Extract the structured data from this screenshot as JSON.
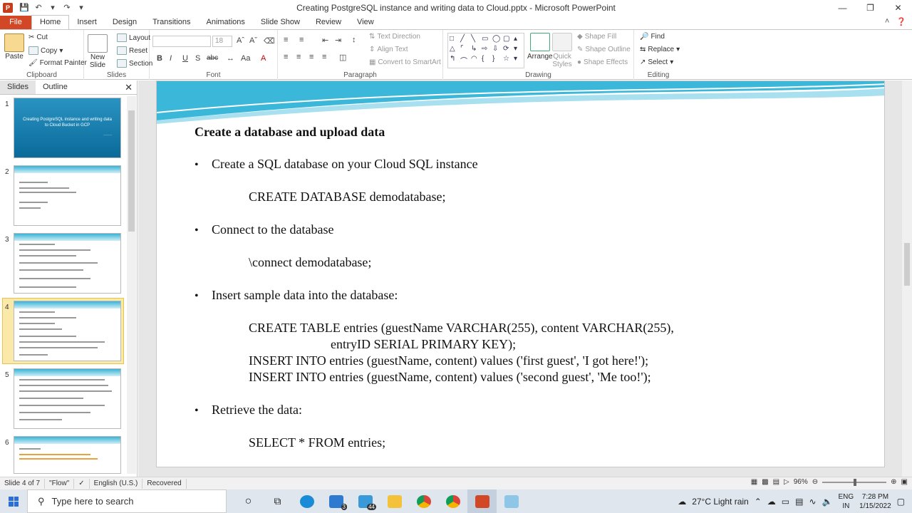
{
  "window": {
    "title": "Creating PostgreSQL instance and writing data to Cloud.pptx - Microsoft PowerPoint",
    "app_icon": "P",
    "controls": [
      "minimize-icon",
      "maximize-icon",
      "close-icon"
    ]
  },
  "ribbon_tabs": [
    {
      "label": "File"
    },
    {
      "label": "Home"
    },
    {
      "label": "Insert"
    },
    {
      "label": "Design"
    },
    {
      "label": "Transitions"
    },
    {
      "label": "Animations"
    },
    {
      "label": "Slide Show"
    },
    {
      "label": "Review"
    },
    {
      "label": "View"
    }
  ],
  "ribbon": {
    "clipboard": {
      "paste": "Paste",
      "cut": "Cut",
      "copy": "Copy",
      "format_painter": "Format Painter",
      "label": "Clipboard"
    },
    "slides": {
      "new_slide": "New Slide",
      "layout": "Layout",
      "reset": "Reset",
      "section": "Section",
      "label": "Slides"
    },
    "font": {
      "font_name": "",
      "font_size": "18",
      "bold": "B",
      "italic": "I",
      "underline": "U",
      "strike": "S",
      "shadow": "abc",
      "label": "Font"
    },
    "paragraph": {
      "text_direction": "Text Direction",
      "align_text": "Align Text",
      "convert": "Convert to SmartArt",
      "label": "Paragraph"
    },
    "drawing": {
      "arrange": "Arrange",
      "quick_styles": "Quick Styles",
      "shape_fill": "Shape Fill",
      "shape_outline": "Shape Outline",
      "shape_effects": "Shape Effects",
      "label": "Drawing"
    },
    "editing": {
      "find": "Find",
      "replace": "Replace",
      "select": "Select",
      "label": "Editing"
    }
  },
  "left_pane": {
    "tabs": [
      "Slides",
      "Outline"
    ],
    "thumbnails": [
      {
        "num": "1",
        "title": "Creating PostgreSQL instance and writing data to Cloud Bucket in GCP"
      },
      {
        "num": "2"
      },
      {
        "num": "3"
      },
      {
        "num": "4"
      },
      {
        "num": "5"
      },
      {
        "num": "6"
      }
    ]
  },
  "slide": {
    "heading": "Create a database and upload data",
    "lines": [
      {
        "bullet": true,
        "text": "Create a SQL database on your Cloud SQL instance"
      },
      {
        "bullet": false,
        "text": "CREATE DATABASE demodatabase;"
      },
      {
        "bullet": true,
        "text": "Connect to the database"
      },
      {
        "bullet": false,
        "text": "\\connect demodatabase;"
      },
      {
        "bullet": true,
        "text": "Insert sample data into the database:"
      },
      {
        "bullet": false,
        "text": "CREATE TABLE entries (guestName VARCHAR(255), content VARCHAR(255),"
      },
      {
        "bullet": false,
        "text": "entryID SERIAL PRIMARY KEY);"
      },
      {
        "bullet": false,
        "text": "INSERT INTO entries (guestName, content) values ('first guest', 'I got here!');"
      },
      {
        "bullet": false,
        "text": "INSERT INTO entries (guestName, content) values ('second guest', 'Me too!');"
      },
      {
        "bullet": true,
        "text": "Retrieve the data:"
      },
      {
        "bullet": false,
        "text": "SELECT * FROM entries;"
      }
    ]
  },
  "status": {
    "slide_of": "Slide 4 of 7",
    "theme": "\"Flow\"",
    "language": "English (U.S.)",
    "recovered": "Recovered",
    "zoom": "96%"
  },
  "taskbar": {
    "search_placeholder": "Type here to search",
    "weather": "27°C  Light rain",
    "lang_top": "ENG",
    "lang_bottom": "IN",
    "time": "7:28 PM",
    "date": "1/15/2022",
    "badges": {
      "mail": "3",
      "teams": "44"
    }
  }
}
